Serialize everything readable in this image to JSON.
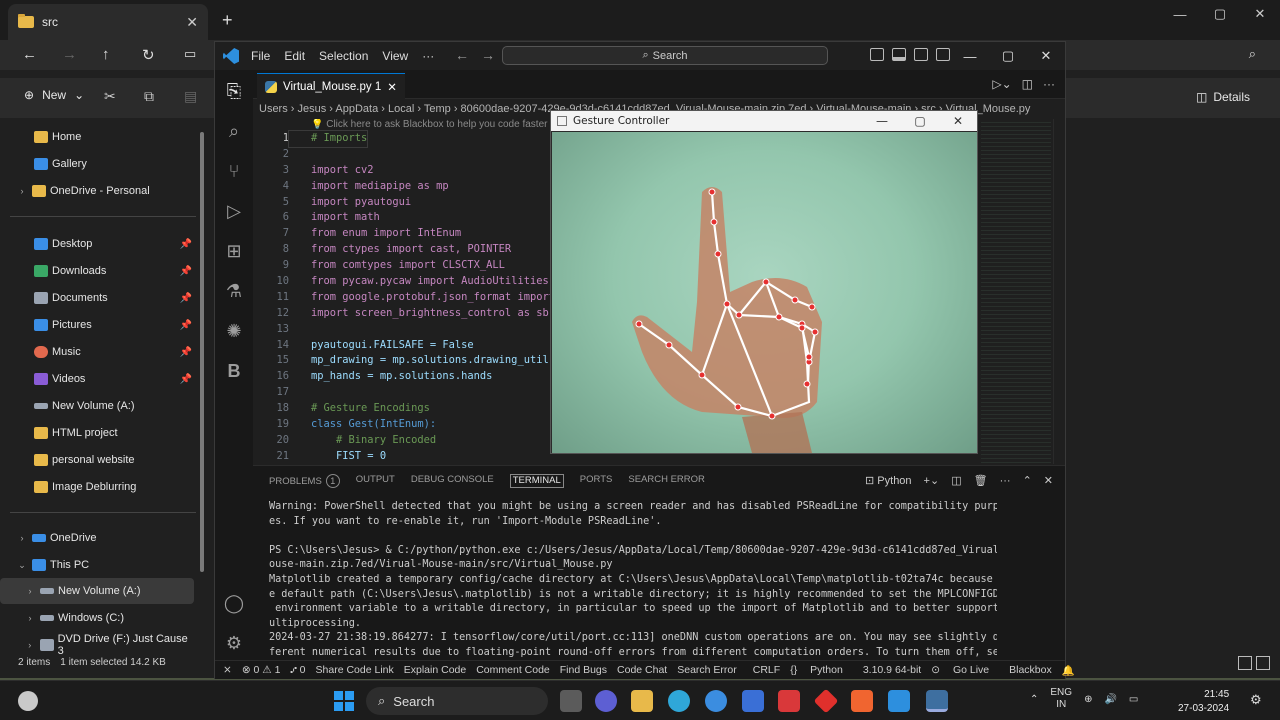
{
  "explorer": {
    "tab_title": "src",
    "new_label": "New",
    "details_label": "Details",
    "sidebar": [
      {
        "label": "Home",
        "color": "#e8b94a"
      },
      {
        "label": "Gallery",
        "color": "#3a8ee6"
      },
      {
        "label": "OneDrive - Personal",
        "color": "#e8b94a"
      },
      {
        "label": "Desktop",
        "color": "#3a8ee6"
      },
      {
        "label": "Downloads",
        "color": "#3aa866"
      },
      {
        "label": "Documents",
        "color": "#9aa4b2"
      },
      {
        "label": "Pictures",
        "color": "#3a8ee6"
      },
      {
        "label": "Music",
        "color": "#e2694e"
      },
      {
        "label": "Videos",
        "color": "#8a5cd6"
      },
      {
        "label": "New Volume (A:)",
        "color": "#9aa4b2"
      },
      {
        "label": "HTML project",
        "color": "#e8b94a"
      },
      {
        "label": "personal website",
        "color": "#e8b94a"
      },
      {
        "label": "Image Deblurring",
        "color": "#e8b94a"
      },
      {
        "label": "OneDrive",
        "color": "#3a8ee6"
      },
      {
        "label": "This PC",
        "color": "#3a8ee6"
      },
      {
        "label": "New Volume (A:)",
        "color": "#9aa4b2"
      },
      {
        "label": "Windows (C:)",
        "color": "#9aa4b2"
      },
      {
        "label": "DVD Drive (F:) Just Cause 3",
        "color": "#9aa4b2"
      }
    ],
    "status": {
      "items": "2 items",
      "selected": "1 item selected  14.2 KB"
    }
  },
  "vscode": {
    "menu": [
      "File",
      "Edit",
      "Selection",
      "View",
      "···"
    ],
    "search_label": "Search",
    "tab_label": "Virtual_Mouse.py 1",
    "breadcrumb": "Users  ›  Jesus  ›  AppData  ›  Local  ›  Temp  ›  80600dae-9207-429e-9d3d-c6141cdd87ed_Virual-Mouse-main.zip.7ed  ›  Virtual-Mouse-main  ›  src  ›  Virtual_Mouse.py",
    "hint": "💡  Click here to ask Blackbox to help you code faster",
    "code_lines": [
      {
        "n": "1",
        "t": "# Imports"
      },
      {
        "n": "2",
        "t": ""
      },
      {
        "n": "3",
        "t": "import cv2"
      },
      {
        "n": "4",
        "t": "import mediapipe as mp"
      },
      {
        "n": "5",
        "t": "import pyautogui"
      },
      {
        "n": "6",
        "t": "import math"
      },
      {
        "n": "7",
        "t": "from enum import IntEnum"
      },
      {
        "n": "8",
        "t": "from ctypes import cast, POINTER"
      },
      {
        "n": "9",
        "t": "from comtypes import CLSCTX_ALL"
      },
      {
        "n": "10",
        "t": "from pycaw.pycaw import AudioUtilities"
      },
      {
        "n": "11",
        "t": "from google.protobuf.json_format import"
      },
      {
        "n": "12",
        "t": "import screen_brightness_control as sb"
      },
      {
        "n": "13",
        "t": ""
      },
      {
        "n": "14",
        "t": "pyautogui.FAILSAFE = False"
      },
      {
        "n": "15",
        "t": "mp_drawing = mp.solutions.drawing_util"
      },
      {
        "n": "16",
        "t": "mp_hands = mp.solutions.hands"
      },
      {
        "n": "17",
        "t": ""
      },
      {
        "n": "18",
        "t": "# Gesture Encodings"
      },
      {
        "n": "19",
        "t": "class Gest(IntEnum):"
      },
      {
        "n": "20",
        "t": "    # Binary Encoded"
      },
      {
        "n": "21",
        "t": "    FIST = 0"
      }
    ],
    "panel_tabs": [
      "PROBLEMS",
      "OUTPUT",
      "DEBUG CONSOLE",
      "TERMINAL",
      "PORTS",
      "SEARCH ERROR"
    ],
    "problems_count": "1",
    "terminal_shell": "Python",
    "terminal_lines": [
      "Warning: PowerShell detected that you might be using a screen reader and has disabled PSReadLine for compatibility purpos",
      "es. If you want to re-enable it, run 'Import-Module PSReadLine'.",
      "",
      "PS C:\\Users\\Jesus> & C:/python/python.exe c:/Users/Jesus/AppData/Local/Temp/80600dae-9207-429e-9d3d-c6141cdd87ed_Virual-M",
      "ouse-main.zip.7ed/Virual-Mouse-main/src/Virtual_Mouse.py",
      "Matplotlib created a temporary config/cache directory at C:\\Users\\Jesus\\AppData\\Local\\Temp\\matplotlib-t02ta74c because th",
      "e default path (C:\\Users\\Jesus\\.matplotlib) is not a writable directory; it is highly recommended to set the MPLCONFIGDIR",
      " environment variable to a writable directory, in particular to speed up the import of Matplotlib and to better support m",
      "ultiprocessing.",
      "2024-03-27 21:38:19.864277: I tensorflow/core/util/port.cc:113] oneDNN custom operations are on. You may see slightly dif",
      "ferent numerical results due to floating-point round-off errors from different computation orders. To turn them off, set"
    ],
    "status": {
      "errors": "⊗ 0 ⚠ 1",
      "ports": "⑇ 0",
      "items": [
        "Share Code Link",
        "Explain Code",
        "Comment Code",
        "Find Bugs",
        "Code Chat",
        "Search Error"
      ],
      "eol": "CRLF",
      "lang": "Python",
      "interpreter": "3.10.9 64-bit",
      "golive": "Go Live",
      "blackbox": "Blackbox"
    }
  },
  "gesture": {
    "title": "Gesture Controller"
  },
  "taskbar": {
    "search": "Search",
    "lang1": "ENG",
    "lang2": "IN",
    "time": "21:45",
    "date": "27-03-2024"
  }
}
